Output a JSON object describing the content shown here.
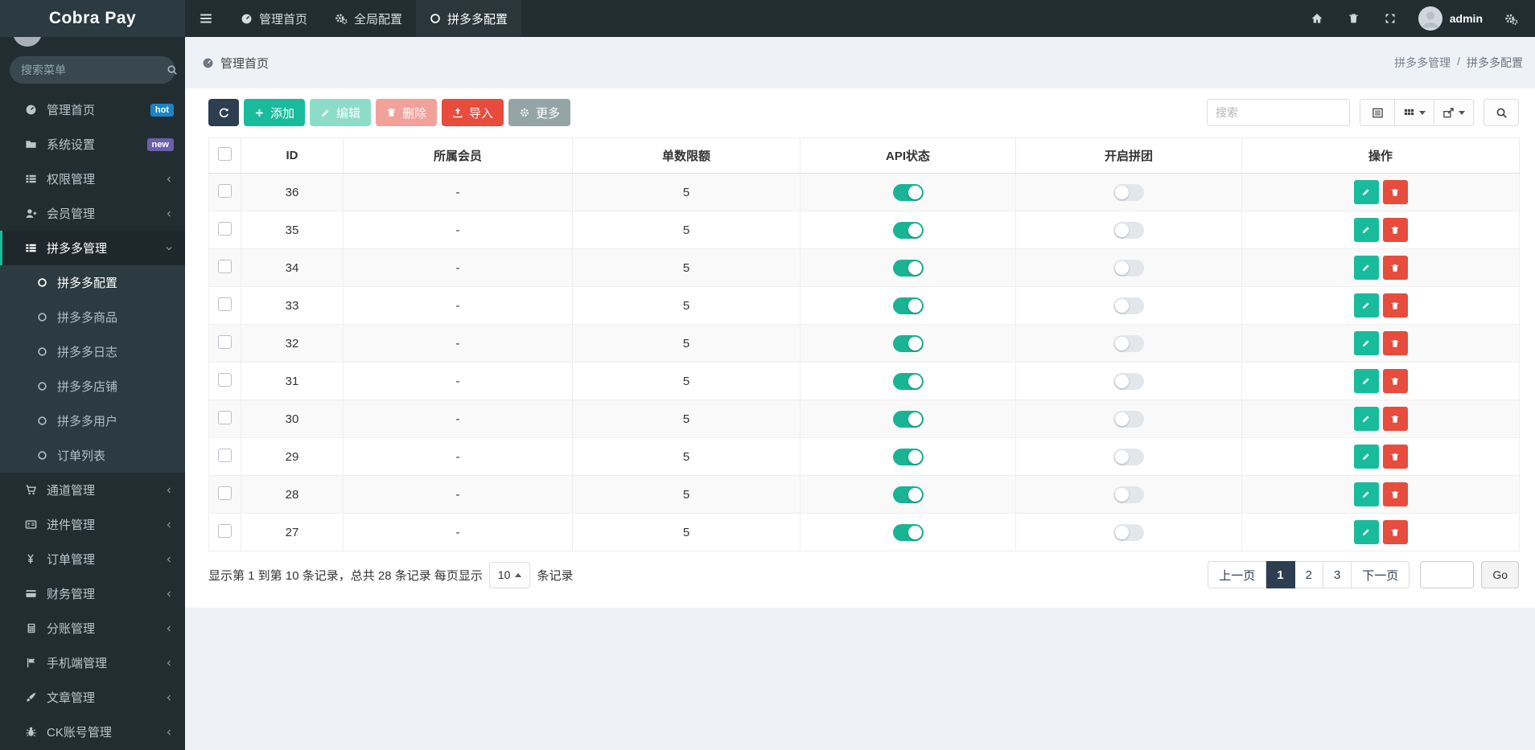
{
  "app": {
    "title": "Cobra Pay"
  },
  "navbar": {
    "tabs": [
      {
        "label": "管理首页"
      },
      {
        "label": "全局配置"
      },
      {
        "label": "拼多多配置"
      }
    ],
    "username": "admin"
  },
  "sidebar": {
    "search_placeholder": "搜索菜单",
    "items": [
      {
        "label": "管理首页",
        "badge": "hot"
      },
      {
        "label": "系统设置",
        "badge": "new"
      },
      {
        "label": "权限管理"
      },
      {
        "label": "会员管理"
      },
      {
        "label": "拼多多管理"
      },
      {
        "label": "通道管理"
      },
      {
        "label": "进件管理"
      },
      {
        "label": "订单管理"
      },
      {
        "label": "财务管理"
      },
      {
        "label": "分账管理"
      },
      {
        "label": "手机端管理"
      },
      {
        "label": "文章管理"
      },
      {
        "label": "CK账号管理"
      }
    ],
    "submenu": [
      {
        "label": "拼多多配置"
      },
      {
        "label": "拼多多商品"
      },
      {
        "label": "拼多多日志"
      },
      {
        "label": "拼多多店铺"
      },
      {
        "label": "拼多多用户"
      },
      {
        "label": "订单列表"
      }
    ]
  },
  "breadcrumb": {
    "left": "管理首页",
    "parent": "拼多多管理",
    "separator": "/",
    "current": "拼多多配置"
  },
  "toolbar": {
    "add": "添加",
    "edit": "编辑",
    "delete": "删除",
    "import": "导入",
    "more": "更多",
    "search_placeholder": "搜索"
  },
  "table": {
    "headers": {
      "id": "ID",
      "member": "所属会员",
      "limit": "单数限额",
      "api": "API状态",
      "group": "开启拼团",
      "ops": "操作"
    },
    "rows": [
      {
        "id": "36",
        "member": "-",
        "limit": "5"
      },
      {
        "id": "35",
        "member": "-",
        "limit": "5"
      },
      {
        "id": "34",
        "member": "-",
        "limit": "5"
      },
      {
        "id": "33",
        "member": "-",
        "limit": "5"
      },
      {
        "id": "32",
        "member": "-",
        "limit": "5"
      },
      {
        "id": "31",
        "member": "-",
        "limit": "5"
      },
      {
        "id": "30",
        "member": "-",
        "limit": "5"
      },
      {
        "id": "29",
        "member": "-",
        "limit": "5"
      },
      {
        "id": "28",
        "member": "-",
        "limit": "5"
      },
      {
        "id": "27",
        "member": "-",
        "limit": "5"
      }
    ]
  },
  "pagination": {
    "summary_prefix": "显示第 1 到第 10 条记录，总共 28 条记录 每页显示",
    "page_size": "10",
    "summary_suffix": "条记录",
    "prev": "上一页",
    "pages": [
      "1",
      "2",
      "3"
    ],
    "next": "下一页",
    "go": "Go"
  },
  "colors": {
    "sidebar_bg": "#222d32",
    "accent_teal": "#18bc9c",
    "toggle_on": "#1ab394",
    "danger": "#e74c3c",
    "primary_dark": "#2c3e50",
    "badge_hot": "#1c84c6",
    "badge_new": "#6a5fa8"
  }
}
